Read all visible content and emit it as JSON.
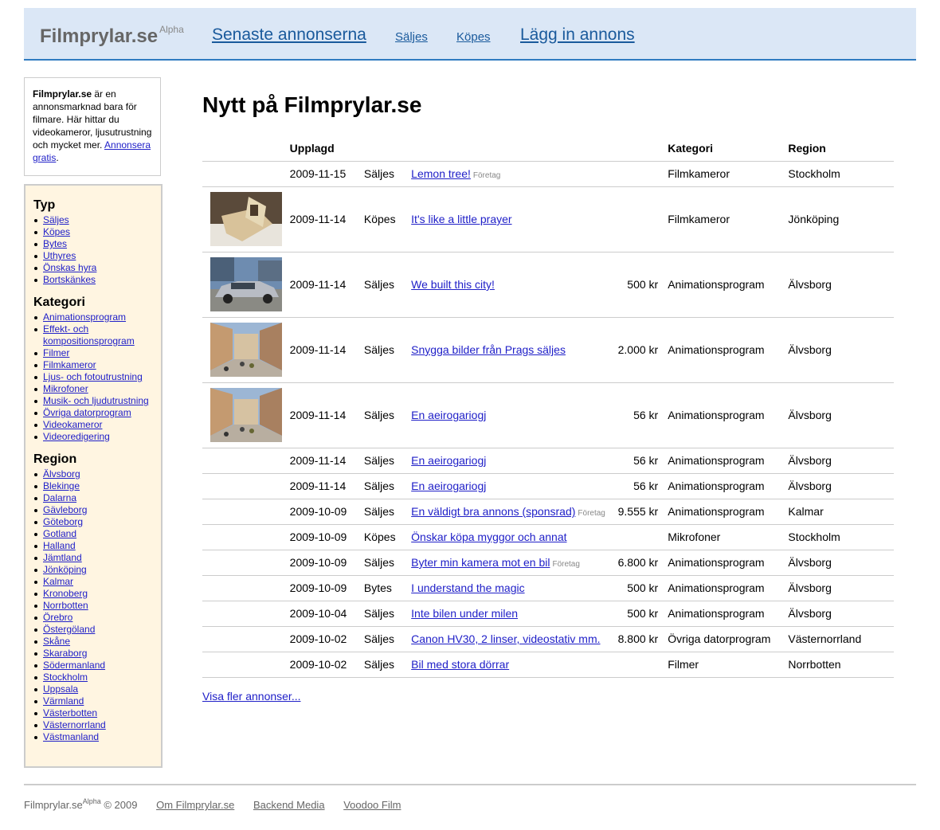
{
  "header": {
    "logo": "Filmprylar.se",
    "logo_sup": "Alpha",
    "nav": {
      "latest": "Senaste annonserna",
      "selling": "Säljes",
      "buying": "Köpes",
      "post": "Lägg in annons"
    }
  },
  "about": {
    "brand": "Filmprylar.se",
    "text": " är en annonsmarknad bara för filmare. Här hittar du videokameror, ljusutrustning och mycket mer. ",
    "link": "Annonsera gratis",
    "end": "."
  },
  "filters": {
    "type_title": "Typ",
    "types": [
      "Säljes",
      "Köpes",
      "Bytes",
      "Uthyres",
      "Önskas hyra",
      "Bortskänkes"
    ],
    "category_title": "Kategori",
    "categories": [
      "Animationsprogram",
      "Effekt- och kompositionsprogram",
      "Filmer",
      "Filmkameror",
      "Ljus- och fotoutrustning",
      "Mikrofoner",
      "Musik- och ljudutrustning",
      "Övriga datorprogram",
      "Videokameror",
      "Videoredigering"
    ],
    "region_title": "Region",
    "regions": [
      "Älvsborg",
      "Blekinge",
      "Dalarna",
      "Gävleborg",
      "Göteborg",
      "Gotland",
      "Halland",
      "Jämtland",
      "Jönköping",
      "Kalmar",
      "Kronoberg",
      "Norrbotten",
      "Örebro",
      "Östergöland",
      "Skåne",
      "Skaraborg",
      "Södermanland",
      "Stockholm",
      "Uppsala",
      "Värmland",
      "Västerbotten",
      "Västernorrland",
      "Västmanland"
    ]
  },
  "main": {
    "title": "Nytt på Filmprylar.se",
    "columns": {
      "posted": "Upplagd",
      "category": "Kategori",
      "region": "Region"
    },
    "company_tag": "Företag",
    "listings": [
      {
        "date": "2009-11-15",
        "type": "Säljes",
        "title": "Lemon tree!",
        "company": true,
        "price": "",
        "category": "Filmkameror",
        "region": "Stockholm",
        "image": ""
      },
      {
        "date": "2009-11-14",
        "type": "Köpes",
        "title": "It's like a little prayer",
        "company": false,
        "price": "",
        "category": "Filmkameror",
        "region": "Jönköping",
        "image": "paper-object"
      },
      {
        "date": "2009-11-14",
        "type": "Säljes",
        "title": "We built this city!",
        "company": false,
        "price": "500 kr",
        "category": "Animationsprogram",
        "region": "Älvsborg",
        "image": "car"
      },
      {
        "date": "2009-11-14",
        "type": "Säljes",
        "title": "Snygga bilder från Prags säljes",
        "company": false,
        "price": "2.000 kr",
        "category": "Animationsprogram",
        "region": "Älvsborg",
        "image": "street"
      },
      {
        "date": "2009-11-14",
        "type": "Säljes",
        "title": "En aeirogariogj",
        "company": false,
        "price": "56 kr",
        "category": "Animationsprogram",
        "region": "Älvsborg",
        "image": "street"
      },
      {
        "date": "2009-11-14",
        "type": "Säljes",
        "title": "En aeirogariogj",
        "company": false,
        "price": "56 kr",
        "category": "Animationsprogram",
        "region": "Älvsborg",
        "image": ""
      },
      {
        "date": "2009-11-14",
        "type": "Säljes",
        "title": "En aeirogariogj",
        "company": false,
        "price": "56 kr",
        "category": "Animationsprogram",
        "region": "Älvsborg",
        "image": ""
      },
      {
        "date": "2009-10-09",
        "type": "Säljes",
        "title": "En väldigt bra annons (sponsrad)",
        "company": true,
        "price": "9.555 kr",
        "category": "Animationsprogram",
        "region": "Kalmar",
        "image": ""
      },
      {
        "date": "2009-10-09",
        "type": "Köpes",
        "title": "Önskar köpa myggor och annat",
        "company": false,
        "price": "",
        "category": "Mikrofoner",
        "region": "Stockholm",
        "image": ""
      },
      {
        "date": "2009-10-09",
        "type": "Säljes",
        "title": "Byter min kamera mot en bil",
        "company": true,
        "price": "6.800 kr",
        "category": "Animationsprogram",
        "region": "Älvsborg",
        "image": ""
      },
      {
        "date": "2009-10-09",
        "type": "Bytes",
        "title": "I understand the magic",
        "company": false,
        "price": "500 kr",
        "category": "Animationsprogram",
        "region": "Älvsborg",
        "image": ""
      },
      {
        "date": "2009-10-04",
        "type": "Säljes",
        "title": "Inte bilen under milen",
        "company": false,
        "price": "500 kr",
        "category": "Animationsprogram",
        "region": "Älvsborg",
        "image": ""
      },
      {
        "date": "2009-10-02",
        "type": "Säljes",
        "title": "Canon HV30, 2 linser, videostativ mm.",
        "company": false,
        "price": "8.800 kr",
        "category": "Övriga datorprogram",
        "region": "Västernorrland",
        "image": ""
      },
      {
        "date": "2009-10-02",
        "type": "Säljes",
        "title": "Bil med stora dörrar",
        "company": false,
        "price": "",
        "category": "Filmer",
        "region": "Norrbotten",
        "image": ""
      }
    ],
    "more_link": "Visa fler annonser..."
  },
  "footer": {
    "brand": "Filmprylar.se",
    "brand_sup": "Alpha",
    "copyright": " © 2009",
    "links": [
      "Om Filmprylar.se",
      "Backend Media",
      "Voodoo Film"
    ]
  }
}
